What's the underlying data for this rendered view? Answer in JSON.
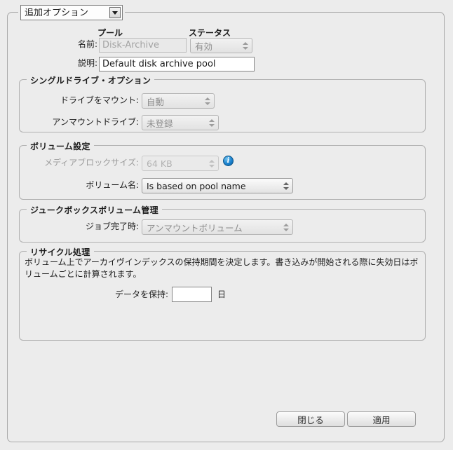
{
  "window": {
    "options_selector": {
      "label": "追加オプション",
      "dropdown_icon": "chevron-down-icon"
    }
  },
  "columns": {
    "pool": "プール",
    "status": "ステータス"
  },
  "pool_fields": {
    "name_label": "名前:",
    "name_value": "Disk-Archive",
    "status_value": "有効",
    "description_label": "説明:",
    "description_value": "Default disk archive pool"
  },
  "single_drive": {
    "title": "シングルドライブ・オプション",
    "mount_drive_label": "ドライブをマウント:",
    "mount_drive_value": "自動",
    "unmount_drive_label": "アンマウントドライブ:",
    "unmount_drive_value": "未登録"
  },
  "volume_settings": {
    "title": "ボリューム設定",
    "media_block_size_label": "メディアブロックサイズ:",
    "media_block_size_value": "64 KB",
    "info_icon": "info-icon",
    "volume_name_label": "ボリューム名:",
    "volume_name_value": "Is based on pool name"
  },
  "jukebox": {
    "title": "ジュークボックスボリューム管理",
    "job_complete_label": "ジョブ完了時:",
    "job_complete_value": "アンマウントボリューム"
  },
  "recycle": {
    "title": "リサイクル処理",
    "description": "ボリューム上でアーカイヴインデックスの保持期間を決定します。書き込みが開始される際に失効日はボリュームごとに計算されます。",
    "retain_label": "データを保持:",
    "retain_value": "",
    "retain_unit": "日"
  },
  "footer": {
    "close_label": "閉じる",
    "apply_label": "適用"
  },
  "colors": {
    "background": "#ececec",
    "info_icon": "#1b82cf",
    "border": "#b0b0b0"
  }
}
